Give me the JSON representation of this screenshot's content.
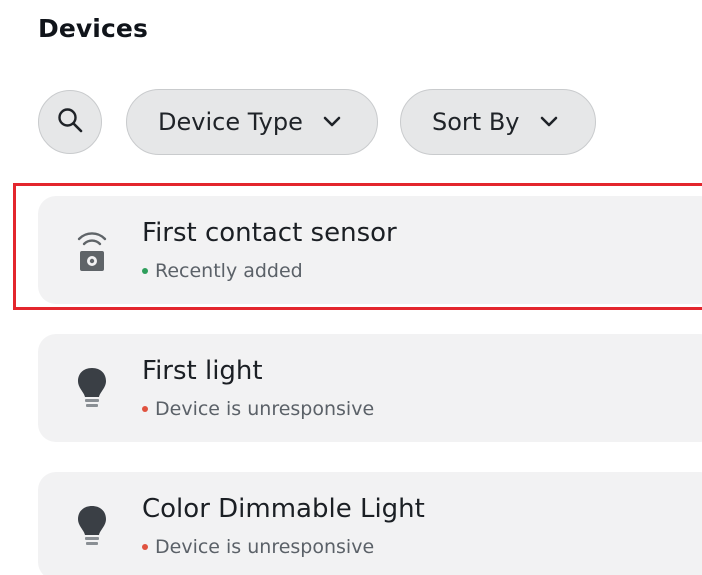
{
  "page": {
    "title": "Devices"
  },
  "filters": {
    "search_icon": "search-icon",
    "device_type_label": "Device Type",
    "sort_by_label": "Sort By"
  },
  "devices": [
    {
      "name": "First contact sensor",
      "status": "Recently added",
      "status_color": "#2e9e5b",
      "icon": "contact-sensor-icon",
      "highlighted": true
    },
    {
      "name": "First light",
      "status": "Device is unresponsive",
      "status_color": "#e0523f",
      "icon": "light-bulb-icon",
      "highlighted": false
    },
    {
      "name": "Color Dimmable Light",
      "status": "Device is unresponsive",
      "status_color": "#e0523f",
      "icon": "light-bulb-icon",
      "highlighted": false
    }
  ],
  "colors": {
    "highlight_border": "#e3262d",
    "card_background": "#f2f2f3",
    "pill_background": "#e6e7e8"
  }
}
